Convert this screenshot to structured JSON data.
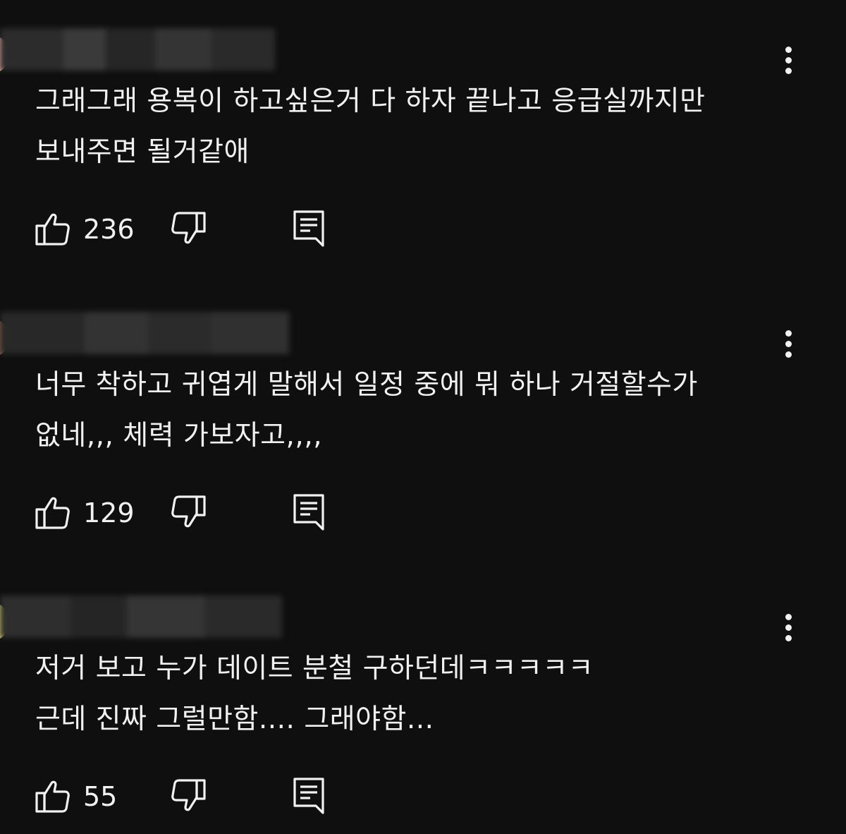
{
  "comments": [
    {
      "lines": [
        "그래그래 용복이 하고싶은거 다 하자  끝나고 응급실까지만",
        "보내주면 될거같애"
      ],
      "like_count": "236",
      "avatar_color": "#e9a8a0"
    },
    {
      "lines": [
        "너무 착하고 귀엽게 말해서 일정 중에 뭐 하나 거절할수가",
        "없네,,, 체력 가보자고,,,,"
      ],
      "like_count": "129",
      "avatar_color": "#8a5a4a"
    },
    {
      "lines": [
        "저거 보고 누가 데이트 분철 구하던데ㅋㅋㅋㅋㅋ",
        "근데 진짜 그럴만함.... 그래야함..."
      ],
      "like_count": "55",
      "avatar_color": "#d8d070"
    }
  ],
  "icons": {
    "like": "thumbs-up-icon",
    "dislike": "thumbs-down-icon",
    "reply": "reply-comment-icon",
    "more": "more-vertical-icon"
  },
  "colors": {
    "background": "#0f0f0f",
    "text": "#f1f1f1"
  }
}
